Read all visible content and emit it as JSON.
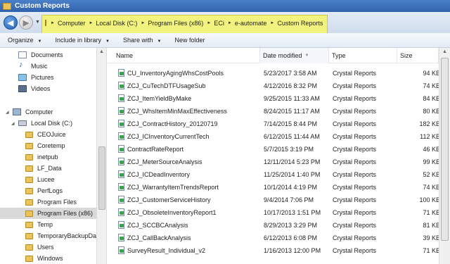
{
  "window": {
    "title": "Custom Reports"
  },
  "address": {
    "crumbs": [
      "Computer",
      "Local Disk (C:)",
      "Program Files (x86)",
      "ECi",
      "e-automate",
      "Custom Reports"
    ]
  },
  "commands": {
    "organize": "Organize",
    "include_in_library": "Include in library",
    "share_with": "Share with",
    "new_folder": "New folder"
  },
  "sidebar": {
    "libraries": [
      {
        "label": "Documents",
        "icon": "documents-icon"
      },
      {
        "label": "Music",
        "icon": "music-icon"
      },
      {
        "label": "Pictures",
        "icon": "pictures-icon"
      },
      {
        "label": "Videos",
        "icon": "videos-icon"
      }
    ],
    "computer": "Computer",
    "disk": "Local Disk (C:)",
    "folders": [
      "CEOJuice",
      "Coretemp",
      "inetpub",
      "LF_Data",
      "Lucee",
      "PerfLogs",
      "Program Files",
      "Program Files (x86)",
      "Temp",
      "TemporaryBackupData",
      "Users",
      "Windows"
    ],
    "selected_folder": "Program Files (x86)"
  },
  "columns": {
    "name": "Name",
    "date": "Date modified",
    "type": "Type",
    "size": "Size"
  },
  "files": [
    {
      "name": "CU_InventoryAgingWhsCostPools",
      "date": "5/23/2017 3:58 AM",
      "type": "Crystal Reports",
      "size": "94 KB"
    },
    {
      "name": "ZCJ_CuTechDTFUsageSub",
      "date": "4/12/2016 8:32 PM",
      "type": "Crystal Reports",
      "size": "74 KB"
    },
    {
      "name": "ZCJ_ItemYieldByMake",
      "date": "9/25/2015 11:33 AM",
      "type": "Crystal Reports",
      "size": "84 KB"
    },
    {
      "name": "ZCJ_WhsItemMinMaxEffectiveness",
      "date": "8/24/2015 11:17 AM",
      "type": "Crystal Reports",
      "size": "80 KB"
    },
    {
      "name": "ZCJ_ContractHistory_20120719",
      "date": "7/14/2015 8:44 PM",
      "type": "Crystal Reports",
      "size": "182 KB"
    },
    {
      "name": "ZCJ_ICInventoryCurrentTech",
      "date": "6/12/2015 11:44 AM",
      "type": "Crystal Reports",
      "size": "112 KB"
    },
    {
      "name": "ContractRateReport",
      "date": "5/7/2015 3:19 PM",
      "type": "Crystal Reports",
      "size": "46 KB"
    },
    {
      "name": "ZCJ_MeterSourceAnalysis",
      "date": "12/11/2014 5:23 PM",
      "type": "Crystal Reports",
      "size": "99 KB"
    },
    {
      "name": "ZCJ_ICDeadInventory",
      "date": "11/25/2014 1:40 PM",
      "type": "Crystal Reports",
      "size": "52 KB"
    },
    {
      "name": "ZCJ_WarrantyItemTrendsReport",
      "date": "10/1/2014 4:19 PM",
      "type": "Crystal Reports",
      "size": "74 KB"
    },
    {
      "name": "ZCJ_CustomerServiceHistory",
      "date": "9/4/2014 7:06 PM",
      "type": "Crystal Reports",
      "size": "100 KB"
    },
    {
      "name": "ZCJ_ObsoleteInventoryReport1",
      "date": "10/17/2013 1:51 PM",
      "type": "Crystal Reports",
      "size": "71 KB"
    },
    {
      "name": "ZCJ_SCCBCAnalysis",
      "date": "8/29/2013 3:29 PM",
      "type": "Crystal Reports",
      "size": "81 KB"
    },
    {
      "name": "ZCJ_CallBackAnalysis",
      "date": "6/12/2013 6:08 PM",
      "type": "Crystal Reports",
      "size": "39 KB"
    },
    {
      "name": "SurveyResult_Individual_v2",
      "date": "1/16/2013 12:00 PM",
      "type": "Crystal Reports",
      "size": "71 KB"
    }
  ],
  "colors": {
    "highlight": "#f1f37e",
    "title_bar": "#3a6fb5",
    "selected": "#d9d9d9"
  }
}
